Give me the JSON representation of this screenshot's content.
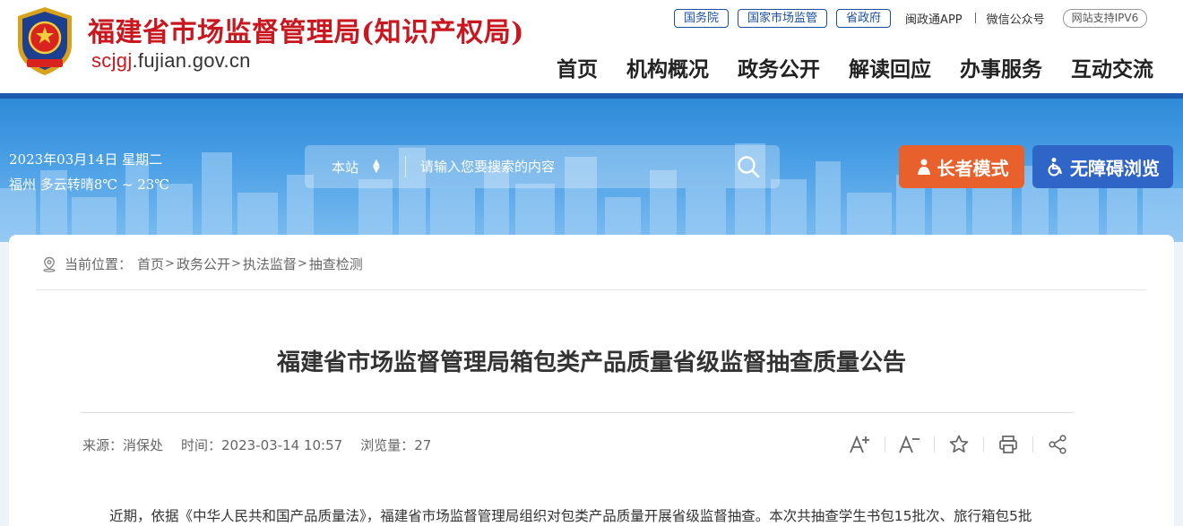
{
  "header": {
    "title": "福建省市场监督管理局(知识产权局)",
    "domain_red": "scjgj",
    "domain_rest": ".fujian.gov.cn"
  },
  "toplinks": {
    "pills": [
      "国务院",
      "国家市场监管",
      "省政府"
    ],
    "app": "闽政通APP",
    "wechat": "微信公众号",
    "ipv6": "网站支持IPV6"
  },
  "nav": [
    "首页",
    "机构概况",
    "政务公开",
    "解读回应",
    "办事服务",
    "互动交流"
  ],
  "info": {
    "date": "2023年03月14日 星期二",
    "weather": "福州 多云转晴8℃ ~ 23℃"
  },
  "search": {
    "scope": "本站",
    "placeholder": "请输入您要搜索的内容"
  },
  "buttons": {
    "elder": "长者模式",
    "access": "无障碍浏览"
  },
  "breadcrumb": {
    "label": "当前位置：",
    "items": [
      "首页",
      "政务公开",
      "执法监督",
      "抽查检测"
    ],
    "sep": ">"
  },
  "article": {
    "title": "福建省市场监督管理局箱包类产品质量省级监督抽查质量公告",
    "source": "来源：消保处",
    "time": "时间：2023-03-14 10:57",
    "views": "浏览量：27",
    "body": "近期，依据《中华人民共和国产品质量法》，福建省市场监督管理局组织对包类产品质量开展省级监督抽查。本次共抽查学生书包15批次、旅行箱包5批"
  },
  "colors": {
    "brand_red": "#c8171e",
    "brand_blue": "#1c5bb0",
    "elder_orange": "#e8612c",
    "access_blue": "#2f65c7"
  }
}
